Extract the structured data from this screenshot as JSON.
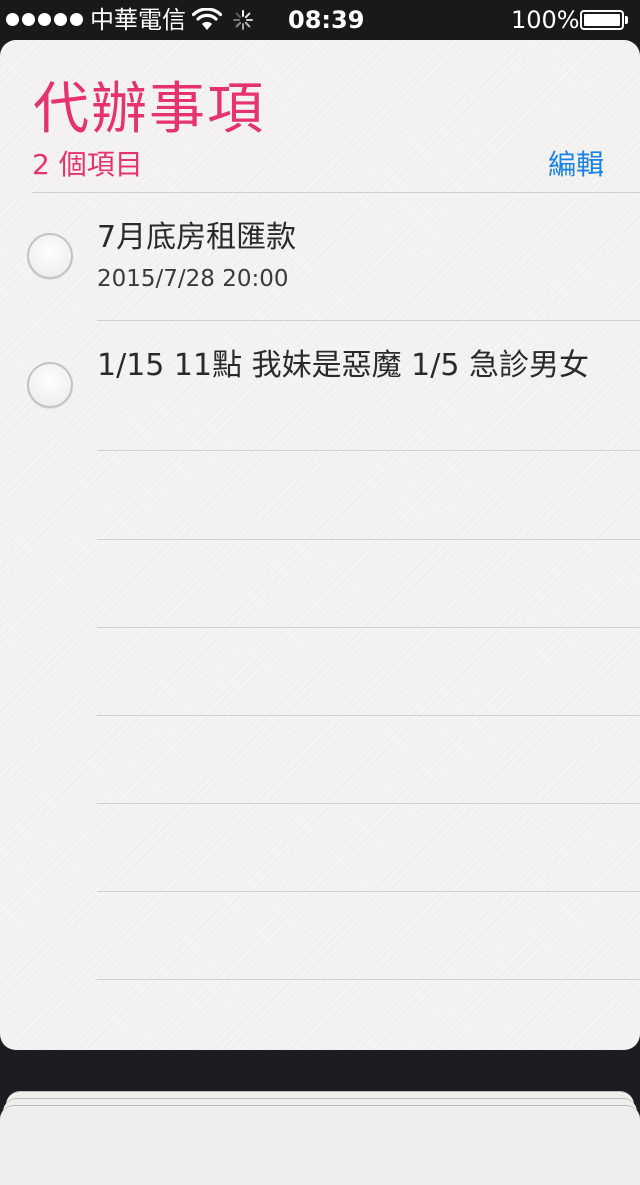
{
  "status_bar": {
    "carrier": "中華電信",
    "time": "08:39",
    "battery_percent": "100%",
    "battery_level": 1.0,
    "signal_dots": 5,
    "icons": [
      "wifi-icon",
      "activity-spinner-icon",
      "battery-icon"
    ]
  },
  "list": {
    "title": "代辦事項",
    "item_count": "2 個項目",
    "edit_label": "編輯",
    "colors": {
      "title": "#e6326f",
      "edit": "#1a83e8"
    },
    "reminders": [
      {
        "text": "7月底房租匯款",
        "date": "2015/7/28 20:00",
        "completed": false
      },
      {
        "text": "1/15 11點 我妹是惡魔 1/5 急診男女",
        "completed": false
      }
    ]
  }
}
